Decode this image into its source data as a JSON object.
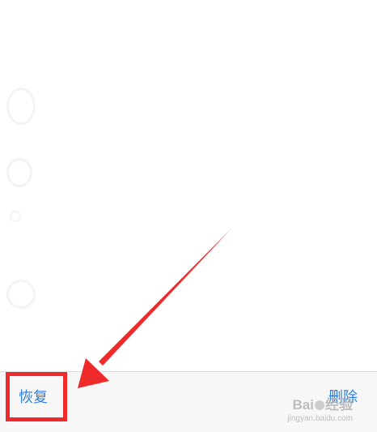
{
  "toolbar": {
    "restore_label": "恢复",
    "delete_label": "删除"
  },
  "annotation": {
    "highlight_color": "#ef2a2a",
    "arrow_color": "#ef2a2a"
  },
  "watermark": {
    "brand_a": "Bai",
    "brand_b": "经验",
    "site": "jingyan.baidu.com"
  },
  "colors": {
    "action_blue": "#2f7de1",
    "toolbar_bg": "#f7f7f7"
  }
}
